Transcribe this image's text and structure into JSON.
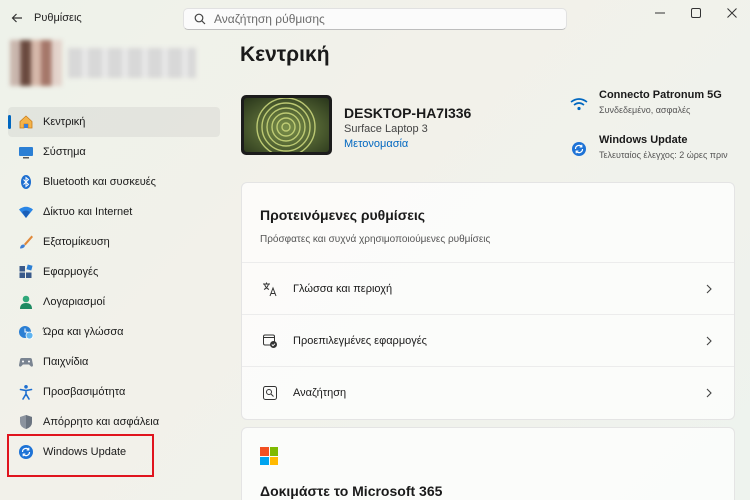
{
  "window": {
    "title": "Ρυθμίσεις",
    "search_placeholder": "Αναζήτηση ρύθμισης"
  },
  "sidebar": {
    "items": [
      {
        "label": "Κεντρική",
        "icon": "home-icon",
        "active": true
      },
      {
        "label": "Σύστημα",
        "icon": "system-icon"
      },
      {
        "label": "Bluetooth και συσκευές",
        "icon": "bluetooth-icon"
      },
      {
        "label": "Δίκτυο και Internet",
        "icon": "network-icon"
      },
      {
        "label": "Εξατομίκευση",
        "icon": "brush-icon"
      },
      {
        "label": "Εφαρμογές",
        "icon": "apps-icon"
      },
      {
        "label": "Λογαριασμοί",
        "icon": "accounts-icon"
      },
      {
        "label": "Ώρα και γλώσσα",
        "icon": "time-language-icon"
      },
      {
        "label": "Παιχνίδια",
        "icon": "gaming-icon"
      },
      {
        "label": "Προσβασιμότητα",
        "icon": "accessibility-icon"
      },
      {
        "label": "Απόρρητο και ασφάλεια",
        "icon": "shield-icon"
      },
      {
        "label": "Windows Update",
        "icon": "windows-update-icon",
        "highlighted": true
      }
    ]
  },
  "main": {
    "title": "Κεντρική",
    "device": {
      "name": "DESKTOP-HA7I336",
      "model": "Surface Laptop 3",
      "rename_label": "Μετονομασία"
    },
    "status": {
      "network": {
        "title": "Connecto Patronum 5G",
        "subtitle": "Συνδεδεμένο, ασφαλές"
      },
      "update": {
        "title": "Windows Update",
        "subtitle": "Τελευταίος έλεγχος: 2 ώρες πριν"
      }
    },
    "recommended": {
      "title": "Προτεινόμενες ρυθμίσεις",
      "subtitle": "Πρόσφατες και συχνά χρησιμοποιούμενες ρυθμίσεις",
      "rows": [
        {
          "label": "Γλώσσα και περιοχή",
          "icon": "language-icon"
        },
        {
          "label": "Προεπιλεγμένες εφαρμογές",
          "icon": "default-apps-icon"
        },
        {
          "label": "Αναζήτηση",
          "icon": "search-settings-icon"
        }
      ]
    },
    "microsoft365": {
      "title": "Δοκιμάστε το Microsoft 365"
    }
  },
  "colors": {
    "accent": "#0067c0",
    "highlight_border": "#e0141e"
  }
}
